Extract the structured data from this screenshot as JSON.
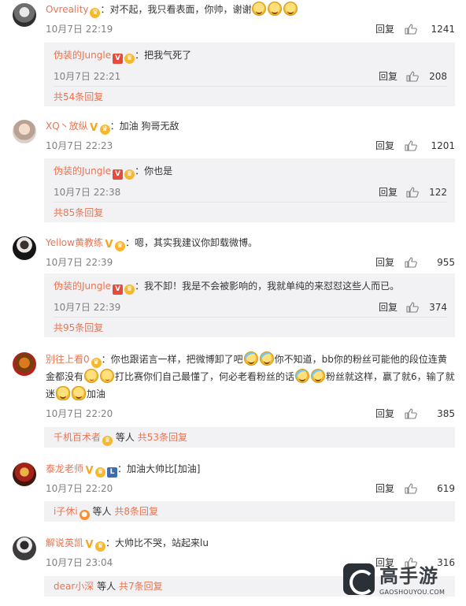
{
  "comments": [
    {
      "user": "Ovreality",
      "badges": [
        "crown"
      ],
      "text": "：对不起，我只看表面，你帅，谢谢",
      "emojis": [
        "grin",
        "grin",
        "grin"
      ],
      "time": "10月7日 22:19",
      "reply_label": "回复",
      "likes": "1241",
      "replies": [
        {
          "user": "伪装的Jungle",
          "badges": [
            "v-red",
            "crown"
          ],
          "text": "：把我气死了",
          "time": "10月7日 22:21",
          "reply_label": "回复",
          "likes": "208"
        }
      ],
      "more": {
        "who": "",
        "others": "",
        "count_text": "共54条回复"
      }
    },
    {
      "user": "XQ丶放纵",
      "badges": [
        "v",
        "crown"
      ],
      "text": "：加油 狗哥无敌",
      "time": "10月7日 22:23",
      "reply_label": "回复",
      "likes": "1201",
      "replies": [
        {
          "user": "伪装的Jungle",
          "badges": [
            "v-red",
            "crown"
          ],
          "text": "：你也是",
          "time": "10月7日 22:38",
          "reply_label": "回复",
          "likes": "122"
        }
      ],
      "more": {
        "who": "",
        "others": "",
        "count_text": "共85条回复"
      }
    },
    {
      "user": "Yellow黄教练",
      "badges": [
        "v",
        "crown"
      ],
      "text": "：嗯，其实我建议你卸载微博。",
      "time": "10月7日 22:39",
      "reply_label": "回复",
      "likes": "955",
      "replies": [
        {
          "user": "伪装的Jungle",
          "badges": [
            "v-red",
            "crown"
          ],
          "text": "：我不卸！我是不会被影响的，我就单纯的来怼怼这些人而已。",
          "time": "10月7日 22:39",
          "reply_label": "回复",
          "likes": "374"
        }
      ],
      "more": {
        "who": "",
        "others": "",
        "count_text": "共95条回复"
      }
    },
    {
      "user": "别往上看0",
      "badges": [
        "crown"
      ],
      "text_parts": [
        "：你也跟诺言一样，把微博卸了吧",
        "你不知道，bb你的粉丝可能他的段位连黄金都没有",
        "打比赛你们自己最懂了，何必老看粉丝的话",
        "粉丝就这样，赢了就6，输了就迷",
        "加油"
      ],
      "time": "10月7日 22:20",
      "reply_label": "回复",
      "likes": "385",
      "replies": [],
      "more": {
        "who": "千机百术者",
        "others": "等人",
        "count_text": "共53条回复"
      }
    },
    {
      "user": "泰龙老师",
      "badges": [
        "v",
        "crown",
        "lv"
      ],
      "text": "：加油大帅比[加油]",
      "time": "10月7日 22:20",
      "reply_label": "回复",
      "likes": "619",
      "replies": [],
      "more": {
        "who": "i子休i",
        "others": "等人",
        "count_text": "共8条回复"
      }
    },
    {
      "user": "解说英凯",
      "badges": [
        "v",
        "crown"
      ],
      "text": "：大帅比不哭，站起来lu",
      "time": "10月7日 23:04",
      "reply_label": "回复",
      "likes": "316",
      "replies": [],
      "more": {
        "who": "dear小深",
        "others": "等人",
        "count_text": "共7条回复"
      }
    }
  ],
  "watermark": {
    "title": "高手游",
    "sub": "GAOSHOUYOU.COM"
  },
  "colors": {
    "username": "#eb7350",
    "text": "#333333",
    "meta": "#808080",
    "subbox": "#f2f2f5"
  }
}
